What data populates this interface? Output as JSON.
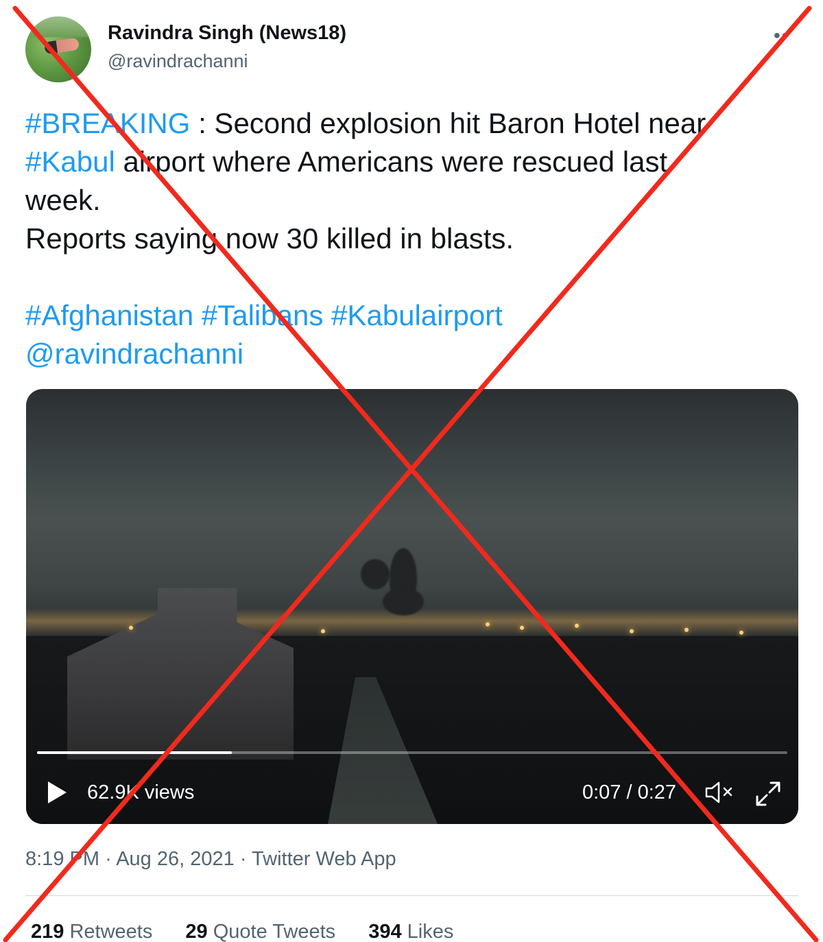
{
  "author": {
    "display_name": "Ravindra Singh (News18)",
    "handle": "@ravindrachanni",
    "more_icon": "more-horizontal-icon"
  },
  "tweet": {
    "lines": [
      {
        "parts": [
          {
            "text": "#BREAKING",
            "link": true
          },
          {
            "text": " : Second explosion hit Baron Hotel near",
            "link": false
          }
        ]
      },
      {
        "parts": [
          {
            "text": "#Kabul",
            "link": true
          },
          {
            "text": " airport where Americans were rescued last",
            "link": false
          }
        ]
      },
      {
        "parts": [
          {
            "text": "week.",
            "link": false
          }
        ]
      },
      {
        "parts": [
          {
            "text": "Reports saying now 30 killed in blasts.",
            "link": false
          }
        ]
      },
      {
        "parts": []
      },
      {
        "parts": [
          {
            "text": "#Afghanistan",
            "link": true
          },
          {
            "text": " ",
            "link": false
          },
          {
            "text": "#Talibans",
            "link": true
          },
          {
            "text": " ",
            "link": false
          },
          {
            "text": "#Kabulairport",
            "link": true
          }
        ]
      },
      {
        "parts": [
          {
            "text": "@ravindrachanni",
            "link": true
          }
        ]
      }
    ]
  },
  "video": {
    "views": "62.9K views",
    "time": "0:07 / 0:27",
    "progress_fraction": 0.26,
    "play_icon": "play-icon",
    "mute_icon": "volume-muted-icon",
    "fullscreen_icon": "fullscreen-expand-icon"
  },
  "meta": {
    "time": "8:19 PM",
    "date": "Aug 26, 2021",
    "source": "Twitter Web App",
    "separator": "·"
  },
  "stats": [
    {
      "count": "219",
      "label": "Retweets"
    },
    {
      "count": "29",
      "label": "Quote Tweets"
    },
    {
      "count": "394",
      "label": "Likes"
    }
  ],
  "colors": {
    "link": "#1d9bf0",
    "text": "#0f1419",
    "secondary": "#536471",
    "cross": "#f02a1d"
  }
}
